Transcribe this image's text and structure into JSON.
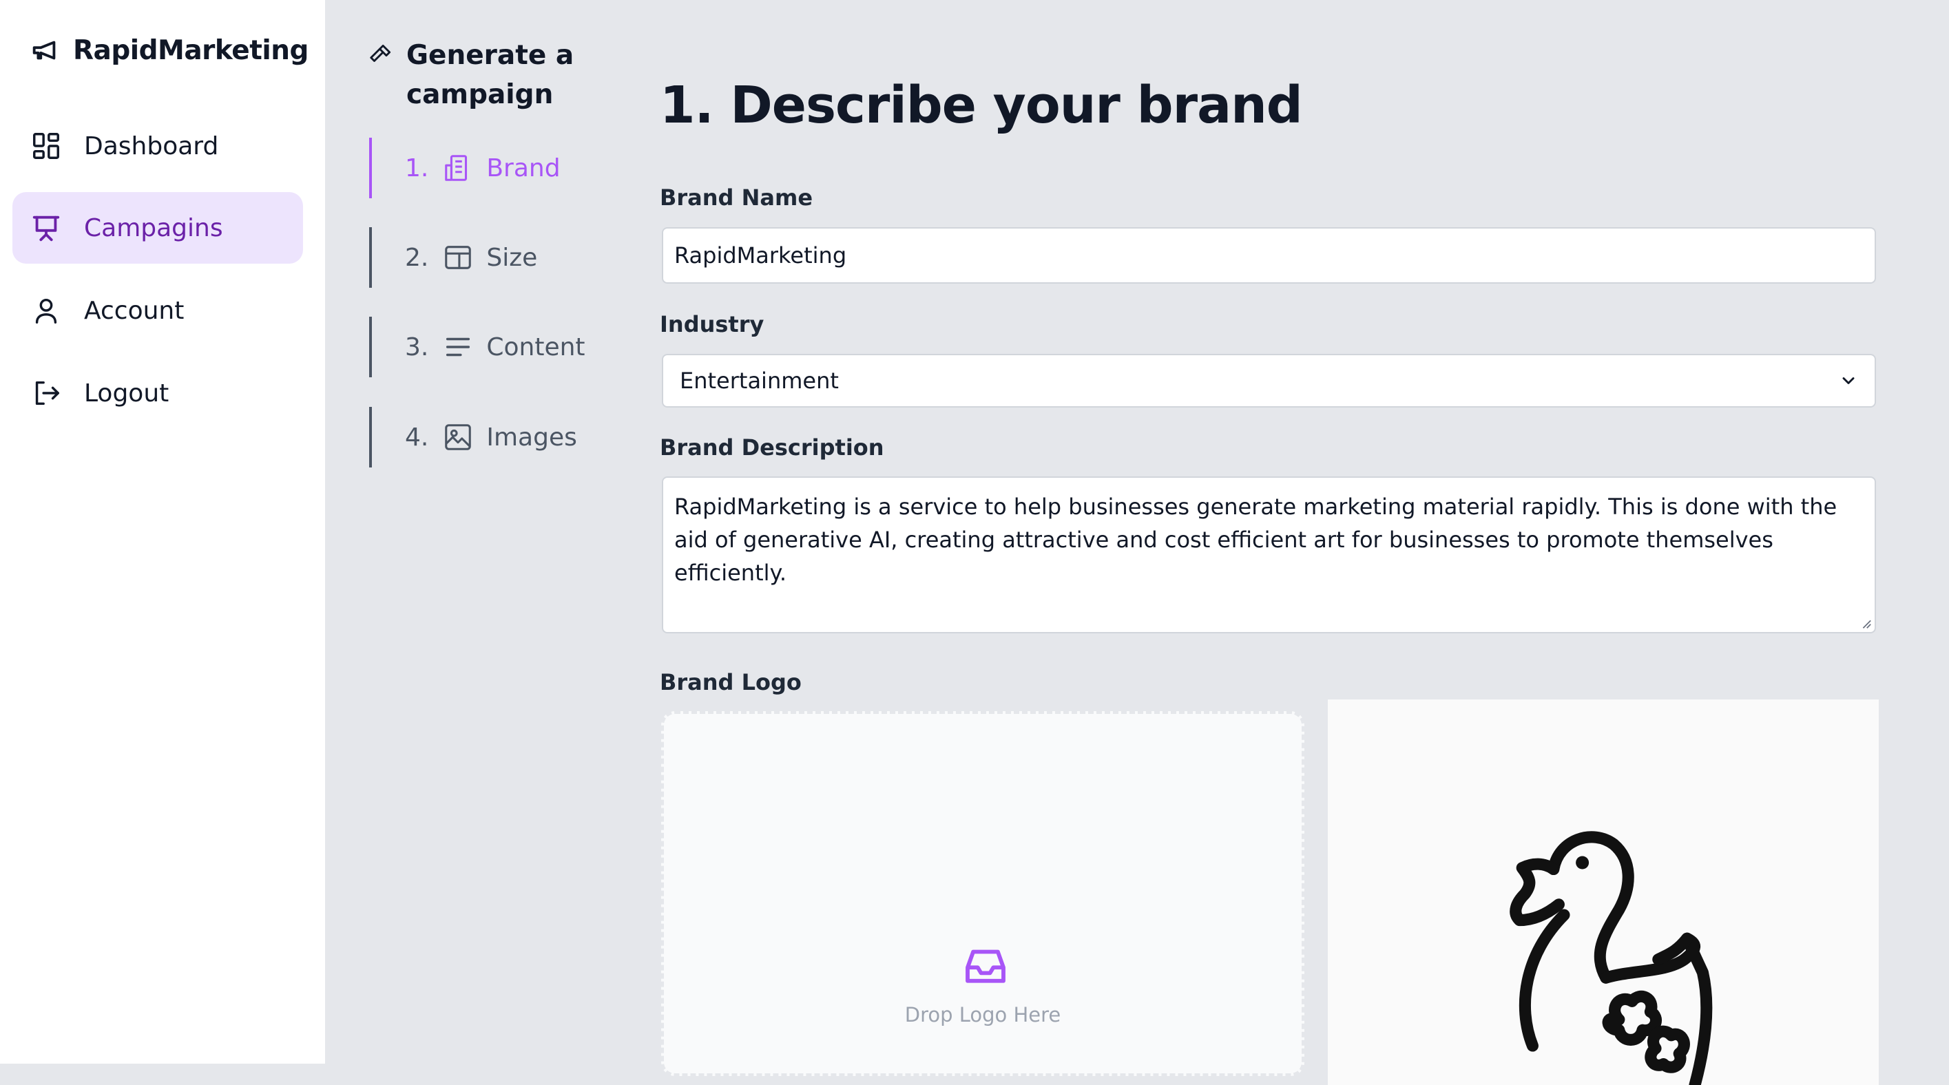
{
  "app": {
    "name": "RapidMarketing"
  },
  "sidebar": {
    "items": [
      {
        "label": "Dashboard",
        "icon": "dashboard-icon"
      },
      {
        "label": "Campagins",
        "icon": "presentation-icon"
      },
      {
        "label": "Account",
        "icon": "user-icon"
      },
      {
        "label": "Logout",
        "icon": "logout-icon"
      }
    ],
    "active_index": 1,
    "accent": "#6b21a8",
    "active_bg": "#ede4fd"
  },
  "wizard": {
    "title": "Generate a campaign",
    "steps": [
      {
        "number": "1.",
        "label": "Brand",
        "icon": "building-icon"
      },
      {
        "number": "2.",
        "label": "Size",
        "icon": "layout-icon"
      },
      {
        "number": "3.",
        "label": "Content",
        "icon": "text-lines-icon"
      },
      {
        "number": "4.",
        "label": "Images",
        "icon": "image-icon"
      }
    ],
    "active_step": 0,
    "accent": "#a855f7"
  },
  "form": {
    "heading": "1. Describe your brand",
    "brand_name": {
      "label": "Brand Name",
      "value": "RapidMarketing"
    },
    "industry": {
      "label": "Industry",
      "value": "Entertainment"
    },
    "description": {
      "label": "Brand Description",
      "value": "RapidMarketing is a service to help businesses generate marketing material rapidly. This is done with the aid of generative AI, creating attractive and cost efficient art for businesses to promote themselves efficiently."
    },
    "logo": {
      "label": "Brand Logo",
      "drop_text": "Drop Logo Here",
      "drop_icon": "inbox-tray-icon",
      "preview_icon": "duck-logo-image"
    }
  }
}
